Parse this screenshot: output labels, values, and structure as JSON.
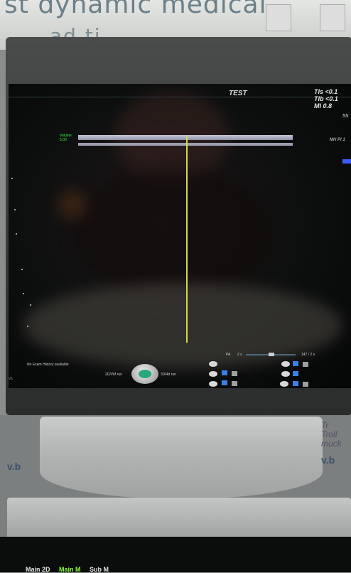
{
  "background": {
    "wall_text_top": "st dynamic medical",
    "wall_text_second": "ad ti ",
    "sticker_left": "v.b",
    "sticker_right_lines": [
      "Tr",
      "Troll",
      "muck",
      "v.b"
    ]
  },
  "ultrasound": {
    "preset_label": "TEST",
    "parameters": [
      "TIs <0.1",
      "TIb <0.1",
      "MI 0.8"
    ],
    "edge_value": "5S",
    "mh_label": "MH PI 1",
    "volume_label_top": "Volume",
    "volume_label_bottom": "5.00",
    "status_message": "No Exam History available",
    "run_left_label": "2D/VM run",
    "run_right_label": "3D/4d run",
    "slider_left_label": "PA",
    "slider_mid_label": "2 s",
    "slider_right_label": "147 / 2 s",
    "edge_label_left": "V1",
    "colors": {
      "cursor": "#d7d64a",
      "volume_text": "#33ff33",
      "knob_center": "#2aa77b",
      "icon_blue": "#3c7fe8",
      "tag_blue": "#3f5cff"
    }
  },
  "control_panel": {
    "tabs": [
      {
        "label": "Main 2D",
        "active": false
      },
      {
        "label": "Main M",
        "active": true
      },
      {
        "label": "Sub M",
        "active": false
      }
    ]
  }
}
